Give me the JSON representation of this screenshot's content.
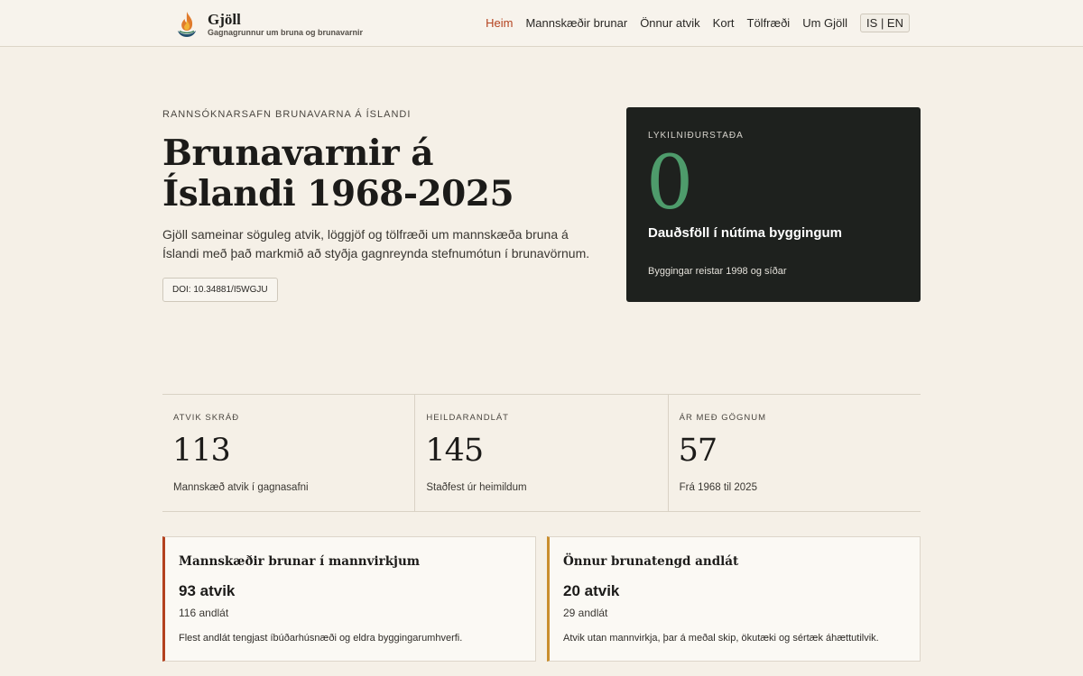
{
  "header": {
    "brand_name": "Gjöll",
    "brand_tagline": "Gagnagrunnur um bruna og brunavarnir",
    "nav": [
      {
        "label": "Heim",
        "active": true
      },
      {
        "label": "Mannskæðir brunar",
        "active": false
      },
      {
        "label": "Önnur atvik",
        "active": false
      },
      {
        "label": "Kort",
        "active": false
      },
      {
        "label": "Tölfræði",
        "active": false
      },
      {
        "label": "Um Gjöll",
        "active": false
      }
    ],
    "lang_label": "IS | EN"
  },
  "hero": {
    "eyebrow": "RANNSÓKNARSAFN BRUNAVARNA Á ÍSLANDI",
    "title": "Brunavarnir á Íslandi 1968-2025",
    "lead": "Gjöll sameinar söguleg atvik, löggjöf og tölfræði um mannskæða bruna á Íslandi með það markmið að styðja gagnreynda stefnumótun í brunavörnum.",
    "doi_label": "DOI: 10.34881/I5WGJU"
  },
  "key_finding": {
    "label": "LYKILNIÐURSTAÐA",
    "number": "0",
    "title": "Dauðsföll í nútíma byggingum",
    "description": "Byggingar reistar 1998 og síðar"
  },
  "stats": [
    {
      "label": "ATVIK SKRÁÐ",
      "value": "113",
      "description": "Mannskæð atvik í gagnasafni"
    },
    {
      "label": "HEILDARANDLÁT",
      "value": "145",
      "description": "Staðfest úr heimildum"
    },
    {
      "label": "ÁR MEÐ GÖGNUM",
      "value": "57",
      "description": "Frá 1968 til 2025"
    }
  ],
  "categories": [
    {
      "title": "Mannskæðir brunar í mannvirkjum",
      "count": "93 atvik",
      "deaths": "116 andlát",
      "description": "Flest andlát tengjast íbúðarhúsnæði og eldra byggingarumhverfi."
    },
    {
      "title": "Önnur brunatengd andlát",
      "count": "20 atvik",
      "deaths": "29 andlát",
      "description": "Atvik utan mannvirkja, þar á meðal skip, ökutæki og sértæk áhættutilvik."
    }
  ],
  "colors": {
    "accent": "#b4421f",
    "background": "#f5f0e7",
    "card_dark": "#1e211e",
    "key_number": "#4e9b6b",
    "category_a_border": "#b4421f",
    "category_b_border": "#c98e2e"
  },
  "icons": {
    "brand_logo": "flame-logo-icon"
  }
}
